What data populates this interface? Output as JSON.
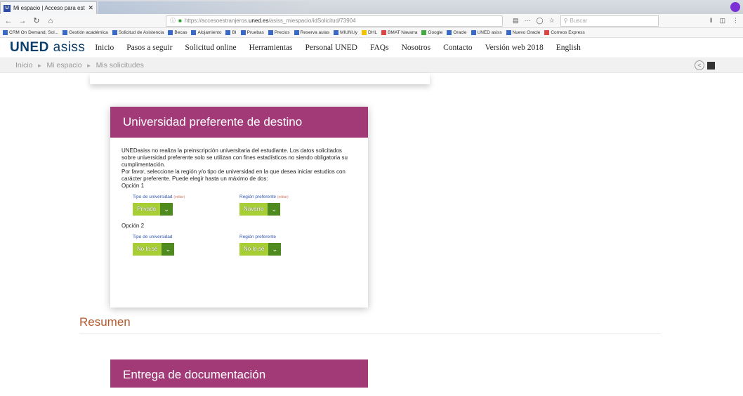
{
  "browser": {
    "tab_title": "Mi espacio | Acceso para estudi",
    "tab_close": "✕",
    "url_prefix": "https://accesoestranjeros.",
    "url_host": "uned.es",
    "url_path": "/asiss_miespacio/idSolicitud/73904",
    "search_placeholder": "Buscar",
    "bookmarks": [
      {
        "label": "CRM On Demand, Sol...",
        "color": "b"
      },
      {
        "label": "Gestión académica",
        "color": "b"
      },
      {
        "label": "Solicitud de Asistencia",
        "color": "b"
      },
      {
        "label": "Becas",
        "color": "b"
      },
      {
        "label": "Alojamiento",
        "color": "b"
      },
      {
        "label": "BI",
        "color": "b"
      },
      {
        "label": "Pruebas",
        "color": "b"
      },
      {
        "label": "Precios",
        "color": "b"
      },
      {
        "label": "Reserva aulas",
        "color": "b"
      },
      {
        "label": "MIUNI.ly",
        "color": "b"
      },
      {
        "label": "DHL",
        "color": "y"
      },
      {
        "label": "BMAT Navarra",
        "color": "r"
      },
      {
        "label": "Google",
        "color": "g"
      },
      {
        "label": "Oracle",
        "color": "b"
      },
      {
        "label": "UNED asiss",
        "color": "b"
      },
      {
        "label": "Nuevo Oracle",
        "color": "b"
      },
      {
        "label": "Correos Express",
        "color": "r"
      }
    ]
  },
  "site": {
    "logo_main": "UNED",
    "logo_sub": "asiss",
    "menu": [
      "Inicio",
      "Pasos a seguir",
      "Solicitud online",
      "Herramientas",
      "Personal UNED",
      "FAQs",
      "Nosotros",
      "Contacto",
      "Versión web 2018",
      "English"
    ]
  },
  "breadcrumb": [
    "Inicio",
    "Mi espacio",
    "Mis solicitudes"
  ],
  "card": {
    "title": "Universidad preferente de destino",
    "text1": "UNEDasiss no realiza la preinscripción universitaria del estudiante. Los datos solicitados sobre universidad preferente solo se utilizan con fines estadísticos no siendo obligatoria su cumplimentación.",
    "text2": "Por favor, seleccione la región y/o tipo de universidad en la que desea iniciar estudios con carácter preferente. Puede elegir hasta un máximo de dos:",
    "option1_label": "Opción 1",
    "option2_label": "Opción 2",
    "tipo_label": "Tipo de universidad",
    "region_label": "Región preferente",
    "required_note": "(editar)",
    "opt1_tipo": "Privada",
    "opt1_region": "Navarra",
    "opt2_tipo": "No lo sé",
    "opt2_region": "No lo sé"
  },
  "resumen_title": "Resumen",
  "card2_title": "Entrega de documentación",
  "colors": {
    "accent": "#a23a78",
    "select_bg": "#a7cf35",
    "select_arrow": "#4f8a1e",
    "heading": "#b15a2e"
  }
}
